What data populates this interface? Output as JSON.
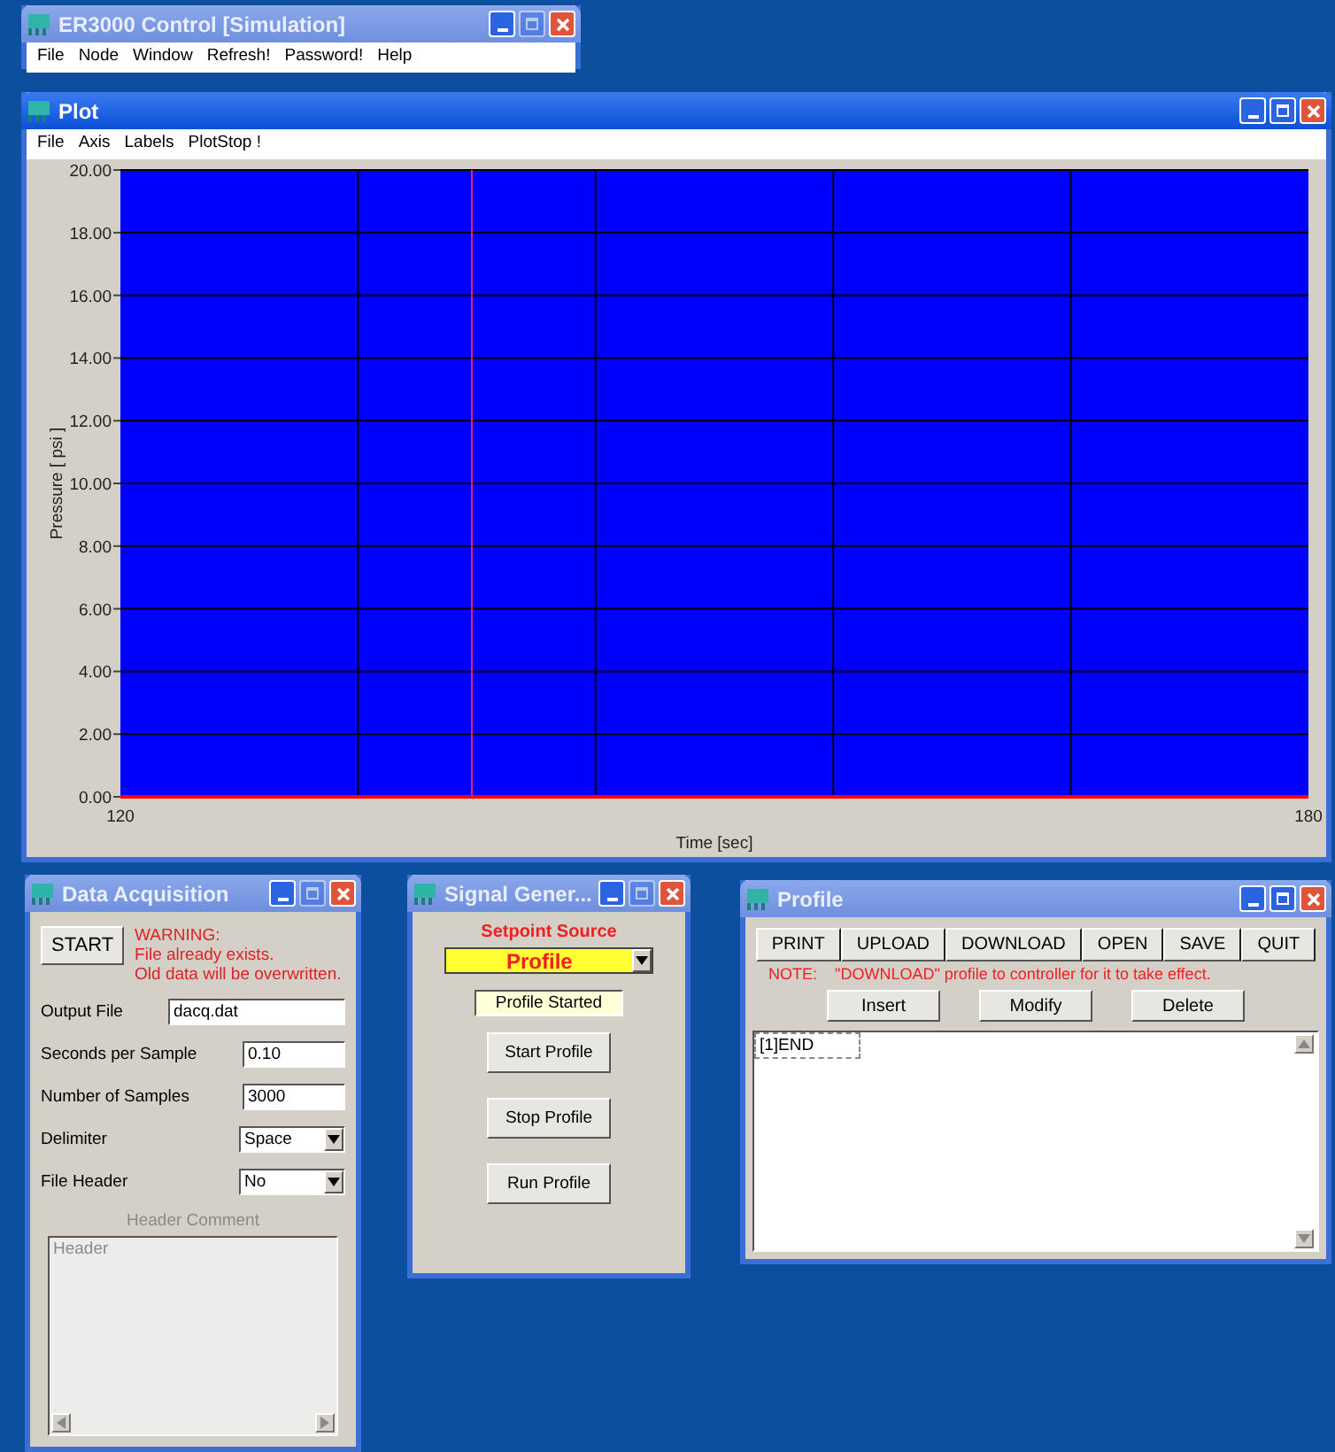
{
  "main_window": {
    "title": "ER3000 Control [Simulation]",
    "active": false,
    "maximize_enabled": false,
    "menu": [
      "File",
      "Node",
      "Window",
      "Refresh!",
      "Password!",
      "Help"
    ]
  },
  "plot_window": {
    "title": "Plot",
    "active": true,
    "maximize_enabled": true,
    "menu": [
      "File",
      "Axis",
      "Labels",
      "PlotStop !"
    ],
    "chart_data": {
      "type": "line",
      "xlabel": "Time [sec]",
      "ylabel": "Pressure [ psi ]",
      "x": [
        120,
        180
      ],
      "grid": true,
      "series": [
        {
          "color": "#ff0000",
          "values": [
            0,
            0
          ]
        }
      ],
      "xlim": [
        120,
        180
      ],
      "ylim": [
        0,
        20
      ],
      "xticks": [
        120,
        180
      ],
      "yticks": [
        {
          "value": 0,
          "label": "0.00"
        },
        {
          "value": 2,
          "label": "2.00"
        },
        {
          "value": 4,
          "label": "4.00"
        },
        {
          "value": 6,
          "label": "6.00"
        },
        {
          "value": 8,
          "label": "8.00"
        },
        {
          "value": 10,
          "label": "10.00"
        },
        {
          "value": 12,
          "label": "12.00"
        },
        {
          "value": 14,
          "label": "14.00"
        },
        {
          "value": 16,
          "label": "16.00"
        },
        {
          "value": 18,
          "label": "18.00"
        },
        {
          "value": 20,
          "label": "20.00"
        }
      ]
    }
  },
  "data_acquisition": {
    "title": "Data Acquisition",
    "active": false,
    "maximize_enabled": false,
    "start_button": "START",
    "warning": [
      "WARNING:",
      "File already exists.",
      "Old data will be overwritten."
    ],
    "fields": [
      {
        "label": "Output File",
        "value": "dacq.dat",
        "kind": "text"
      },
      {
        "label": "Seconds per Sample",
        "value": "0.10",
        "kind": "text"
      },
      {
        "label": "Number of Samples",
        "value": "3000",
        "kind": "text"
      },
      {
        "label": "Delimiter",
        "value": "Space",
        "kind": "select"
      },
      {
        "label": "File Header",
        "value": "No",
        "kind": "select"
      }
    ],
    "header_comment": {
      "label": "Header Comment",
      "placeholder": "Header",
      "disabled": true
    }
  },
  "signal_generator": {
    "title": "Signal Gener...",
    "active": false,
    "maximize_enabled": false,
    "setpoint_label": "Setpoint Source",
    "setpoint_value": "Profile",
    "status": "Profile Started",
    "buttons": [
      "Start Profile",
      "Stop Profile",
      "Run Profile"
    ]
  },
  "profile_window": {
    "title": "Profile",
    "active": false,
    "maximize_enabled": true,
    "toolbar": [
      "PRINT",
      "UPLOAD",
      "DOWNLOAD",
      "OPEN",
      "SAVE",
      "QUIT"
    ],
    "note_label": "NOTE:",
    "note": "\"DOWNLOAD\" profile to controller for it to take effect.",
    "actions": [
      "Insert",
      "Modify",
      "Delete"
    ],
    "steps": [
      {
        "text": "[1]END",
        "selected": true
      }
    ]
  }
}
